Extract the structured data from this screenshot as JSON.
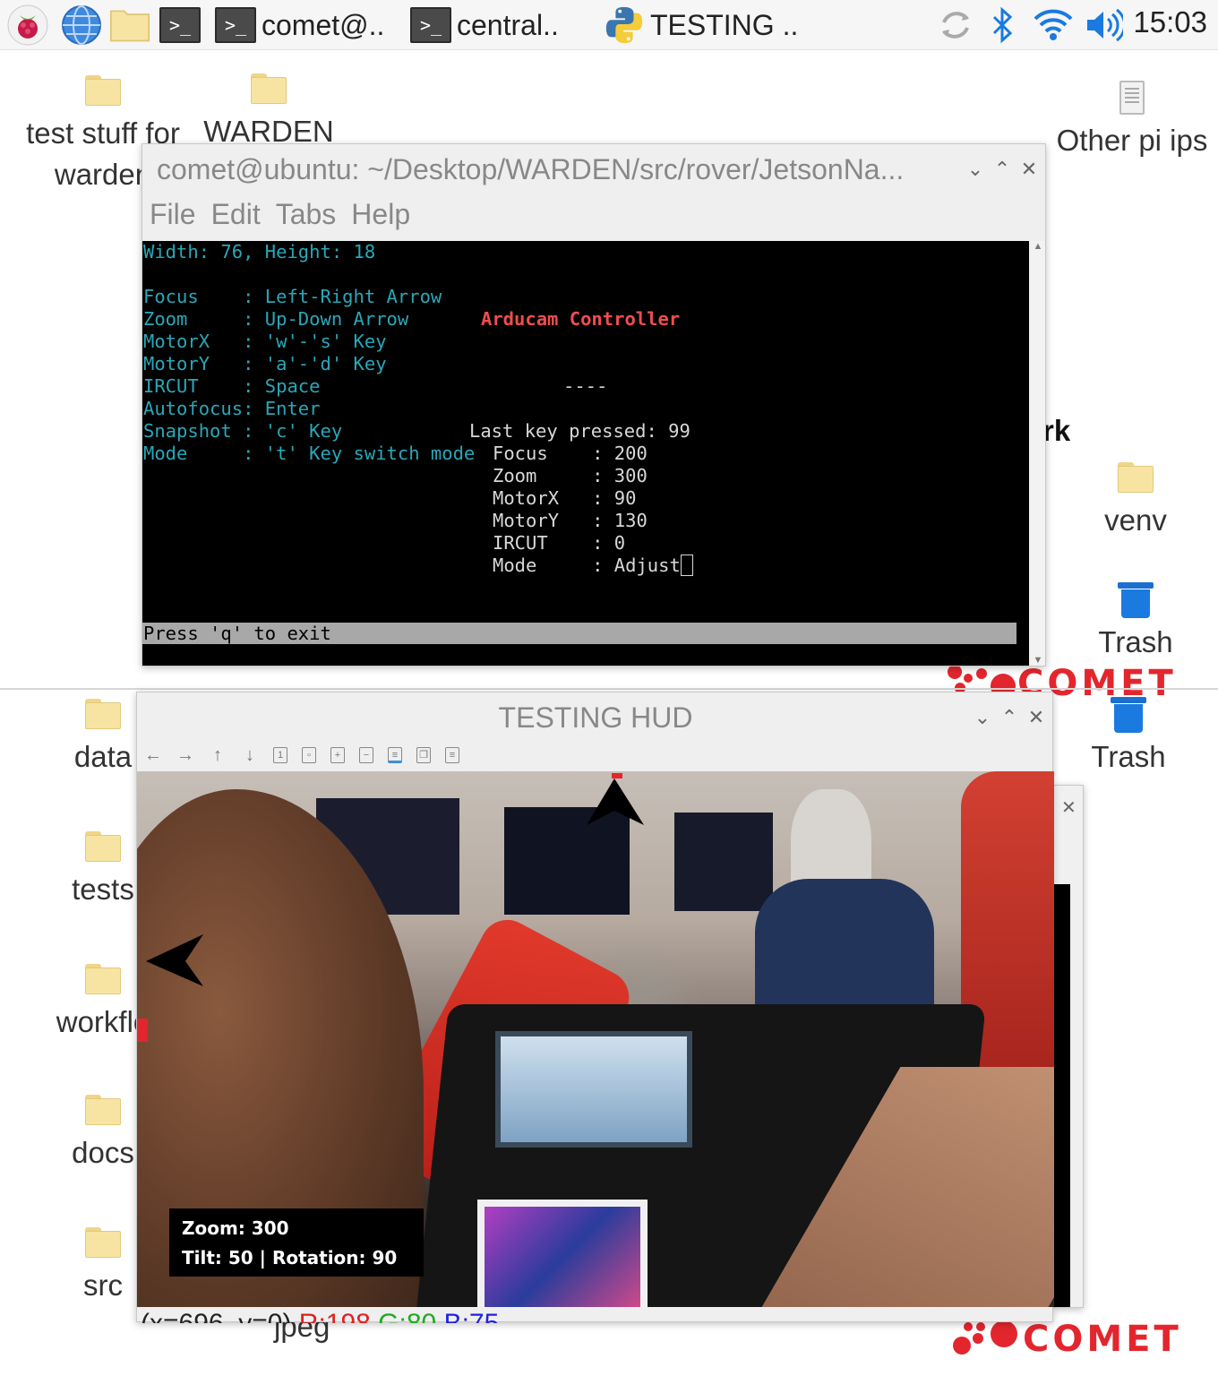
{
  "taskbar": {
    "apps": [
      {
        "icon": "raspberry-pi-menu-icon",
        "label": ""
      },
      {
        "icon": "web-browser-icon",
        "label": ""
      },
      {
        "icon": "file-manager-icon",
        "label": ""
      },
      {
        "icon": "terminal-icon",
        "label": ""
      },
      {
        "icon": "terminal-icon",
        "label": "comet@.."
      },
      {
        "icon": "terminal-icon",
        "label": "central.."
      },
      {
        "icon": "python-icon",
        "label": "TESTING .."
      }
    ],
    "tray": [
      "sync-icon",
      "bluetooth-icon",
      "wifi-icon",
      "volume-icon"
    ],
    "clock": "15:03"
  },
  "desktop": {
    "icons": {
      "test_stuff": [
        "test stuff for",
        "warden"
      ],
      "warden": "WARDEN",
      "other_pi_ips": "Other pi ips",
      "venv": "venv",
      "trash_upper": "Trash",
      "trash_lower": "Trash",
      "data": "data",
      "tests": "tests",
      "workflow": "workflo",
      "docs": "docs",
      "src": "src",
      "jpeg": "jpeg",
      "partial_rk": "rk"
    },
    "logo_text": "COMET",
    "accent_color": "#e3262e"
  },
  "terminal_window": {
    "title": "comet@ubuntu: ~/Desktop/WARDEN/src/rover/JetsonNa...",
    "menu": [
      "File",
      "Edit",
      "Tabs",
      "Help"
    ],
    "size_line": "Width: 76, Height: 18",
    "controls": [
      {
        "name": "Focus    ",
        "desc": ": Left-Right Arrow"
      },
      {
        "name": "Zoom     ",
        "desc": ": Up-Down Arrow"
      },
      {
        "name": "MotorX   ",
        "desc": ": 'w'-'s' Key"
      },
      {
        "name": "MotorY   ",
        "desc": ": 'a'-'d' Key"
      },
      {
        "name": "IRCUT    ",
        "desc": ": Space"
      },
      {
        "name": "Autofocus",
        "desc": ": Enter"
      },
      {
        "name": "Snapshot ",
        "desc": ": 'c' Key"
      },
      {
        "name": "Mode     ",
        "desc": ": 't' Key switch mode"
      }
    ],
    "app_title": "Arducam Controller",
    "separator": "----",
    "last_key": "Last key pressed: 99",
    "status": [
      {
        "name": "Focus    ",
        "value": ": 200"
      },
      {
        "name": "Zoom     ",
        "value": ": 300"
      },
      {
        "name": "MotorX   ",
        "value": ": 90"
      },
      {
        "name": "MotorY   ",
        "value": ": 130"
      },
      {
        "name": "IRCUT    ",
        "value": ": 0"
      },
      {
        "name": "Mode     ",
        "value": ": Adjust"
      }
    ],
    "exit_hint": "Press 'q' to exit"
  },
  "hud_window": {
    "title": "TESTING HUD",
    "toolbar": [
      "←",
      "→",
      "↑",
      "↓"
    ],
    "overlay": {
      "zoom_line": "Zoom: 300",
      "tilt_line": "Tilt: 50 | Rotation: 90"
    },
    "status_partial": {
      "coords": "(x=696, y=0)",
      "r": "R:198",
      "g": "G:80",
      "b": "B:75"
    }
  },
  "window_controls": {
    "minimize": "⌄",
    "maximize": "⌃",
    "close": "✕"
  }
}
